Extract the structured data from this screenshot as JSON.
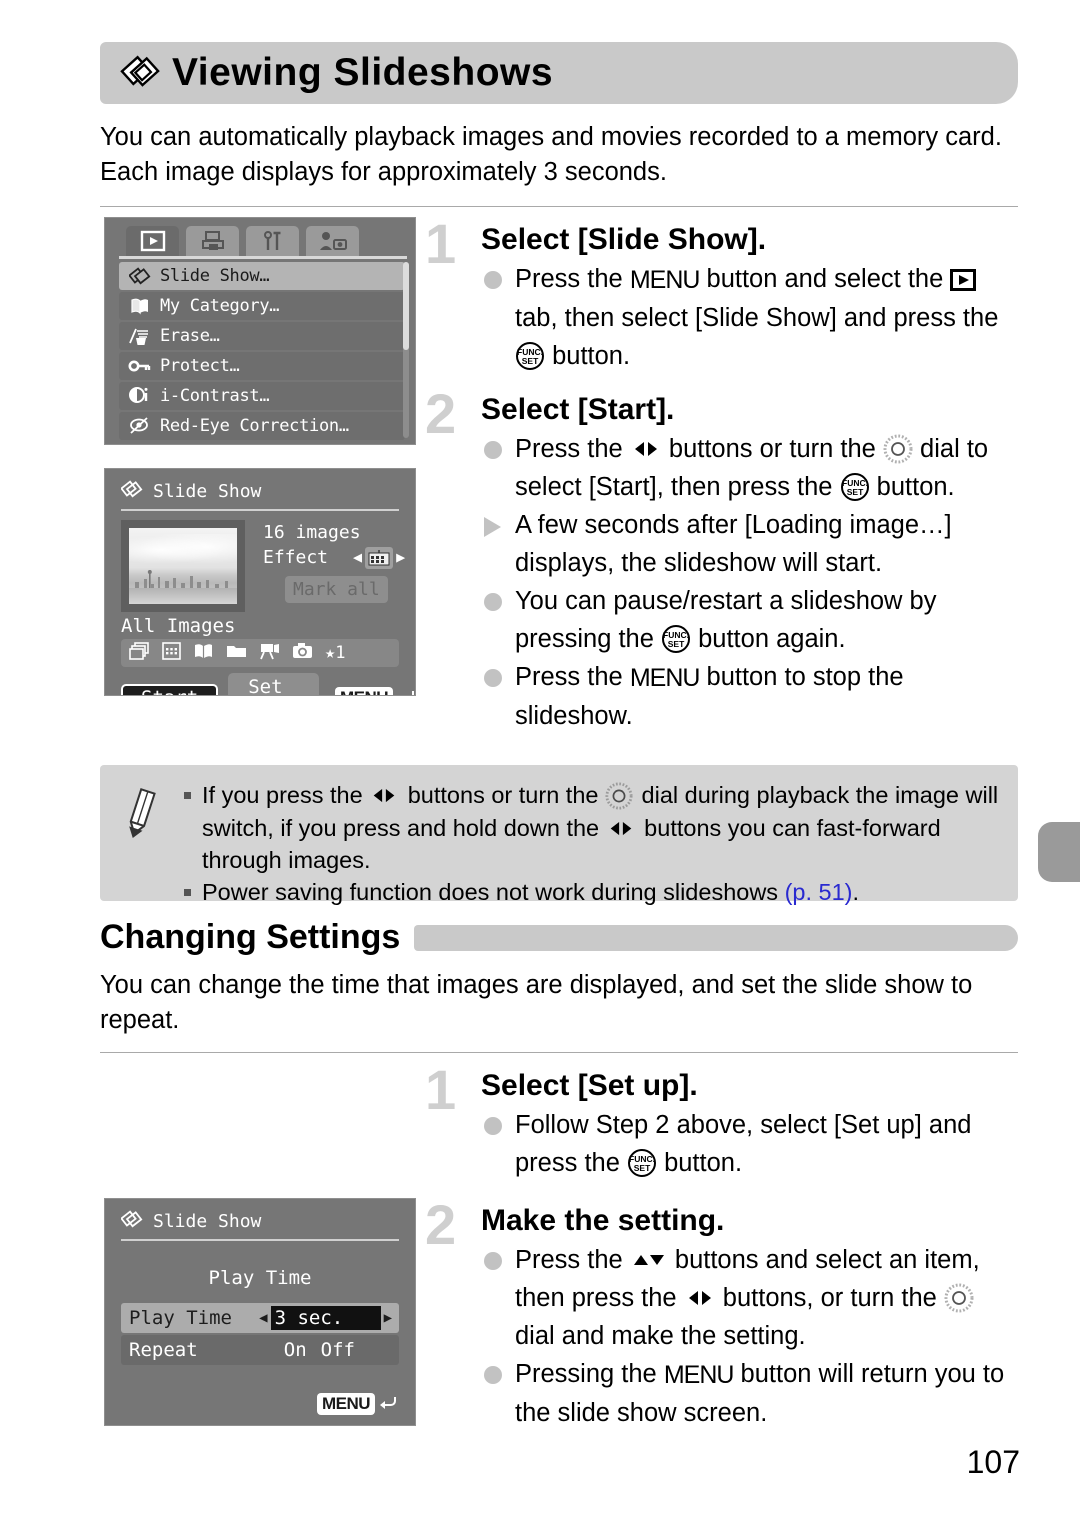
{
  "header": {
    "title": "Viewing Slideshows",
    "icon": "slideshow-icon"
  },
  "intro": "You can automatically playback images and movies recorded to a memory card. Each image displays for approximately 3 seconds.",
  "screens": {
    "playback_menu": {
      "tabs": [
        "playback-tab",
        "print-tab",
        "settings-tab",
        "my-camera-tab"
      ],
      "items": [
        {
          "label": "Slide Show…",
          "icon": "slideshow-icon",
          "selected": true
        },
        {
          "label": "My Category…",
          "icon": "my-category-icon",
          "selected": false
        },
        {
          "label": "Erase…",
          "icon": "erase-icon",
          "selected": false
        },
        {
          "label": "Protect…",
          "icon": "protect-key-icon",
          "selected": false
        },
        {
          "label": "i-Contrast…",
          "icon": "i-contrast-icon",
          "selected": false
        },
        {
          "label": "Red-Eye Correction…",
          "icon": "red-eye-icon",
          "selected": false
        }
      ]
    },
    "slide_show": {
      "title": "Slide Show",
      "image_count": "16 images",
      "effect_label": "Effect",
      "mark_all": "Mark all",
      "filter_label": "All Images",
      "filter_icons": [
        "all-images-icon",
        "date-icon",
        "my-category-icon",
        "folder-icon",
        "movie-icon",
        "stills-icon",
        "star-rating-icon"
      ],
      "star_label": "1",
      "start_button": "Start",
      "setup_button": "Set up",
      "menu_badge": "MENU"
    },
    "play_time": {
      "title": "Slide Show",
      "heading": "Play Time",
      "rows": [
        {
          "label": "Play Time",
          "value": "3 sec.",
          "selected": true
        },
        {
          "label": "Repeat",
          "on": "On",
          "off": "Off",
          "selected": false
        }
      ],
      "menu_badge": "MENU"
    }
  },
  "steps_top": [
    {
      "number": "1",
      "heading": "Select [Slide Show].",
      "bullets": [
        {
          "type": "dot",
          "parts": [
            {
              "t": "text",
              "v": "Press the "
            },
            {
              "t": "icon",
              "v": "menu-button-icon"
            },
            {
              "t": "text",
              "v": " button and select the "
            },
            {
              "t": "icon",
              "v": "playback-tab-icon"
            },
            {
              "t": "text",
              "v": " tab, then select [Slide Show] and press the "
            },
            {
              "t": "icon",
              "v": "func-set-button-icon"
            },
            {
              "t": "text",
              "v": " button."
            }
          ]
        }
      ]
    },
    {
      "number": "2",
      "heading": "Select [Start].",
      "bullets": [
        {
          "type": "dot",
          "parts": [
            {
              "t": "text",
              "v": "Press the "
            },
            {
              "t": "icon",
              "v": "left-right-buttons-icon"
            },
            {
              "t": "text",
              "v": " buttons or turn the "
            },
            {
              "t": "icon",
              "v": "control-dial-icon"
            },
            {
              "t": "text",
              "v": " dial to select [Start], then press the "
            },
            {
              "t": "icon",
              "v": "func-set-button-icon"
            },
            {
              "t": "text",
              "v": " button."
            }
          ]
        },
        {
          "type": "triangle",
          "parts": [
            {
              "t": "text",
              "v": "A few seconds after [Loading image…] displays, the slideshow will start."
            }
          ]
        },
        {
          "type": "dot",
          "parts": [
            {
              "t": "text",
              "v": "You can pause/restart a slideshow by pressing the "
            },
            {
              "t": "icon",
              "v": "func-set-button-icon"
            },
            {
              "t": "text",
              "v": " button again."
            }
          ]
        },
        {
          "type": "dot",
          "parts": [
            {
              "t": "text",
              "v": "Press the "
            },
            {
              "t": "icon",
              "v": "menu-button-icon"
            },
            {
              "t": "text",
              "v": " button to stop the slideshow."
            }
          ]
        }
      ]
    }
  ],
  "note": {
    "icon": "pencil-icon",
    "items": [
      {
        "parts": [
          {
            "t": "text",
            "v": "If you press the "
          },
          {
            "t": "icon",
            "v": "left-right-buttons-icon"
          },
          {
            "t": "text",
            "v": " buttons or turn the "
          },
          {
            "t": "icon",
            "v": "control-dial-icon"
          },
          {
            "t": "text",
            "v": " dial during playback the image will switch, if you press and hold down the "
          },
          {
            "t": "icon",
            "v": "left-right-buttons-icon"
          },
          {
            "t": "text",
            "v": " buttons you can fast-forward through images."
          }
        ]
      },
      {
        "parts": [
          {
            "t": "text",
            "v": "Power saving function does not work during slideshows "
          },
          {
            "t": "ref",
            "v": "(p. 51)"
          },
          {
            "t": "text",
            "v": "."
          }
        ]
      }
    ]
  },
  "section": {
    "title": "Changing Settings",
    "intro": "You can change the time that images are displayed, and set the slide show to repeat."
  },
  "steps_bottom": [
    {
      "number": "1",
      "heading": "Select [Set up].",
      "bullets": [
        {
          "type": "dot",
          "parts": [
            {
              "t": "text",
              "v": "Follow Step 2 above, select [Set up] and press the "
            },
            {
              "t": "icon",
              "v": "func-set-button-icon"
            },
            {
              "t": "text",
              "v": " button."
            }
          ]
        }
      ]
    },
    {
      "number": "2",
      "heading": "Make the setting.",
      "bullets": [
        {
          "type": "dot",
          "parts": [
            {
              "t": "text",
              "v": "Press the "
            },
            {
              "t": "icon",
              "v": "up-down-buttons-icon"
            },
            {
              "t": "text",
              "v": " buttons and select an item, then press the "
            },
            {
              "t": "icon",
              "v": "left-right-buttons-icon"
            },
            {
              "t": "text",
              "v": " buttons, or turn the "
            },
            {
              "t": "icon",
              "v": "control-dial-icon"
            },
            {
              "t": "text",
              "v": " dial and make the setting."
            }
          ]
        },
        {
          "type": "dot",
          "parts": [
            {
              "t": "text",
              "v": "Pressing the "
            },
            {
              "t": "icon",
              "v": "menu-button-icon"
            },
            {
              "t": "text",
              "v": " button will return you to the slide show screen."
            }
          ]
        }
      ]
    }
  ],
  "page_number": "107",
  "colors": {
    "band": "#c9c9c9",
    "note_bg": "#d4d4d4",
    "lcd_bg": "#767676",
    "ref_link": "#2a2ad0",
    "step_number": "#cfcfcf"
  }
}
